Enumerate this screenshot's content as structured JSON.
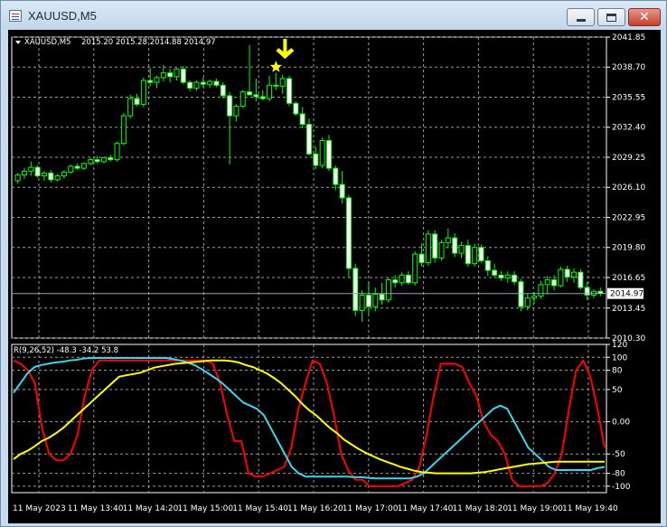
{
  "window": {
    "title": "XAUUSD,M5",
    "buttons": {
      "minimize": "minimize",
      "maximize": "maximize",
      "close": "close"
    }
  },
  "colors": {
    "background": "#000000",
    "grid": "#9a9a9a",
    "candle": "#00ff00",
    "candle_up_fill": "#000000",
    "candle_down_fill": "#ffffff",
    "price_line": "#8fa8b8",
    "arrow": "#ffff00",
    "indicator_red": "#ff0000",
    "indicator_cyan": "#3ad6f0",
    "indicator_yellow": "#ffff00"
  },
  "chart_data": [
    {
      "type": "candlestick",
      "symbol_label": "XAUUSD,M5",
      "ohlc_label": "2015.20 2015.28 2014.88 2014.97",
      "y_ticks": [
        "2041.85",
        "2038.70",
        "2035.55",
        "2032.40",
        "2029.25",
        "2026.10",
        "2022.95",
        "2019.80",
        "2016.65",
        "2013.45",
        "2010.30"
      ],
      "ylim": [
        2010.3,
        2041.85
      ],
      "current_price": "2014.97",
      "x_labels": [
        "11 May 2023",
        "11 May 13:40",
        "11 May 14:20",
        "11 May 15:00",
        "11 May 15:40",
        "11 May 16:20",
        "11 May 17:00",
        "11 May 17:40",
        "11 May 18:20",
        "11 May 19:00",
        "11 May 19:40"
      ],
      "marker": {
        "type": "down-arrow-star",
        "price": 2039.0,
        "bar_index": 39
      },
      "ohlc": [
        [
          2026.8,
          2027.6,
          2026.5,
          2027.4
        ],
        [
          2027.4,
          2028.1,
          2027.0,
          2027.8
        ],
        [
          2027.8,
          2028.8,
          2027.3,
          2028.2
        ],
        [
          2028.2,
          2028.4,
          2027.1,
          2027.3
        ],
        [
          2027.3,
          2027.8,
          2026.8,
          2027.6
        ],
        [
          2027.6,
          2027.9,
          2026.6,
          2026.9
        ],
        [
          2026.9,
          2027.5,
          2026.7,
          2027.3
        ],
        [
          2027.3,
          2027.9,
          2027.0,
          2027.7
        ],
        [
          2027.7,
          2028.5,
          2027.5,
          2028.3
        ],
        [
          2028.3,
          2028.6,
          2027.9,
          2028.1
        ],
        [
          2028.1,
          2028.7,
          2027.9,
          2028.6
        ],
        [
          2028.6,
          2029.2,
          2028.4,
          2029.0
        ],
        [
          2029.0,
          2029.4,
          2028.6,
          2028.8
        ],
        [
          2028.8,
          2029.3,
          2028.6,
          2029.2
        ],
        [
          2029.2,
          2029.5,
          2028.8,
          2029.0
        ],
        [
          2029.0,
          2030.9,
          2028.8,
          2030.7
        ],
        [
          2030.7,
          2033.9,
          2030.5,
          2033.6
        ],
        [
          2033.6,
          2035.8,
          2033.3,
          2035.4
        ],
        [
          2035.4,
          2035.9,
          2034.6,
          2034.8
        ],
        [
          2034.8,
          2037.6,
          2034.5,
          2037.3
        ],
        [
          2037.3,
          2038.6,
          2036.7,
          2037.1
        ],
        [
          2037.1,
          2037.8,
          2036.5,
          2037.6
        ],
        [
          2037.6,
          2038.9,
          2037.2,
          2038.1
        ],
        [
          2038.1,
          2038.5,
          2037.1,
          2037.7
        ],
        [
          2037.7,
          2038.6,
          2037.3,
          2038.5
        ],
        [
          2038.5,
          2038.8,
          2036.9,
          2037.1
        ],
        [
          2037.1,
          2037.3,
          2036.2,
          2036.5
        ],
        [
          2036.5,
          2037.3,
          2036.2,
          2037.1
        ],
        [
          2037.1,
          2037.6,
          2036.6,
          2036.9
        ],
        [
          2036.9,
          2037.4,
          2036.5,
          2037.2
        ],
        [
          2037.2,
          2037.5,
          2036.6,
          2036.8
        ],
        [
          2036.8,
          2037.1,
          2035.4,
          2035.7
        ],
        [
          2035.7,
          2036.1,
          2028.5,
          2033.6
        ],
        [
          2033.6,
          2034.8,
          2033.0,
          2034.6
        ],
        [
          2034.6,
          2036.3,
          2034.4,
          2036.1
        ],
        [
          2036.1,
          2041.0,
          2035.7,
          2035.8
        ],
        [
          2035.8,
          2037.5,
          2035.1,
          2035.6
        ],
        [
          2035.6,
          2036.3,
          2035.2,
          2035.4
        ],
        [
          2035.4,
          2037.8,
          2035.1,
          2036.8
        ],
        [
          2036.8,
          2038.1,
          2036.3,
          2036.7
        ],
        [
          2036.7,
          2037.9,
          2035.9,
          2037.5
        ],
        [
          2037.5,
          2037.8,
          2034.6,
          2034.9
        ],
        [
          2034.9,
          2035.1,
          2033.6,
          2033.8
        ],
        [
          2033.8,
          2034.5,
          2032.3,
          2032.7
        ],
        [
          2032.7,
          2033.3,
          2029.4,
          2029.6
        ],
        [
          2029.6,
          2030.4,
          2028.0,
          2028.4
        ],
        [
          2028.4,
          2031.3,
          2028.1,
          2031.0
        ],
        [
          2031.0,
          2031.6,
          2027.8,
          2028.1
        ],
        [
          2028.1,
          2028.4,
          2025.8,
          2026.4
        ],
        [
          2026.4,
          2027.8,
          2024.4,
          2025.0
        ],
        [
          2025.0,
          2025.3,
          2016.7,
          2017.6
        ],
        [
          2017.6,
          2018.1,
          2012.6,
          2013.2
        ],
        [
          2013.2,
          2015.3,
          2012.0,
          2014.8
        ],
        [
          2014.8,
          2016.2,
          2012.8,
          2013.6
        ],
        [
          2013.6,
          2015.6,
          2013.1,
          2014.9
        ],
        [
          2014.9,
          2016.1,
          2013.8,
          2014.3
        ],
        [
          2014.3,
          2016.7,
          2014.0,
          2016.4
        ],
        [
          2016.4,
          2016.9,
          2015.6,
          2016.1
        ],
        [
          2016.1,
          2017.2,
          2015.8,
          2016.9
        ],
        [
          2016.9,
          2017.3,
          2015.9,
          2016.1
        ],
        [
          2016.1,
          2019.4,
          2015.8,
          2019.1
        ],
        [
          2019.1,
          2020.2,
          2017.8,
          2018.2
        ],
        [
          2018.2,
          2021.6,
          2017.9,
          2021.2
        ],
        [
          2021.2,
          2021.6,
          2018.2,
          2018.7
        ],
        [
          2018.7,
          2020.6,
          2018.4,
          2020.3
        ],
        [
          2020.3,
          2021.8,
          2019.7,
          2020.8
        ],
        [
          2020.8,
          2021.3,
          2018.8,
          2019.2
        ],
        [
          2019.2,
          2020.4,
          2018.7,
          2020.0
        ],
        [
          2020.0,
          2020.6,
          2017.8,
          2018.1
        ],
        [
          2018.1,
          2020.2,
          2017.8,
          2019.8
        ],
        [
          2019.8,
          2020.1,
          2018.2,
          2018.4
        ],
        [
          2018.4,
          2018.9,
          2016.8,
          2017.4
        ],
        [
          2017.4,
          2018.1,
          2016.6,
          2016.9
        ],
        [
          2016.9,
          2017.3,
          2016.3,
          2016.6
        ],
        [
          2016.6,
          2017.3,
          2016.1,
          2016.9
        ],
        [
          2016.9,
          2017.3,
          2015.9,
          2016.2
        ],
        [
          2016.2,
          2016.5,
          2013.1,
          2013.6
        ],
        [
          2013.6,
          2014.9,
          2013.2,
          2014.5
        ],
        [
          2014.5,
          2015.1,
          2013.9,
          2014.7
        ],
        [
          2014.7,
          2016.3,
          2014.4,
          2015.9
        ],
        [
          2015.9,
          2016.8,
          2014.9,
          2016.4
        ],
        [
          2016.4,
          2016.9,
          2015.3,
          2015.8
        ],
        [
          2015.8,
          2017.8,
          2015.6,
          2017.5
        ],
        [
          2017.5,
          2017.9,
          2016.2,
          2016.7
        ],
        [
          2016.7,
          2017.6,
          2016.1,
          2017.2
        ],
        [
          2017.2,
          2017.5,
          2015.4,
          2015.6
        ],
        [
          2015.6,
          2016.2,
          2014.3,
          2014.8
        ],
        [
          2014.8,
          2015.4,
          2014.5,
          2015.2
        ],
        [
          2015.2,
          2015.6,
          2014.7,
          2014.97
        ]
      ]
    },
    {
      "type": "line",
      "label": "R(9,26,52) -48.3 -34.2 53.8",
      "y_ticks": [
        "120",
        "100",
        "80",
        "50",
        "0.00",
        "-50",
        "-80",
        "-100"
      ],
      "ylim": [
        -110,
        120
      ],
      "series": [
        {
          "color": "#ff0000",
          "values": [
            95,
            90,
            80,
            60,
            -10,
            -50,
            -60,
            -60,
            -50,
            -20,
            40,
            80,
            95,
            95,
            95,
            95,
            95,
            95,
            95,
            95,
            95,
            95,
            95,
            95,
            95,
            95,
            95,
            95,
            90,
            60,
            10,
            -30,
            -30,
            -80,
            -85,
            -85,
            -80,
            -75,
            -70,
            -40,
            20,
            60,
            95,
            90,
            60,
            10,
            -50,
            -75,
            -90,
            -90,
            -100,
            -100,
            -100,
            -100,
            -100,
            -95,
            -90,
            -70,
            -20,
            40,
            90,
            90,
            90,
            85,
            60,
            40,
            0,
            -20,
            -30,
            -50,
            -90,
            -100,
            -100,
            -100,
            -100,
            -95,
            -80,
            -50,
            20,
            80,
            95,
            70,
            20,
            -40
          ]
        },
        {
          "color": "#3ad6f0",
          "values": [
            45,
            60,
            75,
            85,
            88,
            90,
            92,
            93,
            95,
            96,
            98,
            99,
            99,
            99,
            99,
            99,
            99,
            99,
            99,
            99,
            99,
            99,
            99,
            97,
            95,
            92,
            88,
            82,
            75,
            68,
            60,
            50,
            40,
            30,
            25,
            20,
            10,
            -10,
            -30,
            -50,
            -70,
            -80,
            -85,
            -85,
            -85,
            -85,
            -85,
            -85,
            -85,
            -86,
            -86,
            -87,
            -88,
            -88,
            -88,
            -88,
            -88,
            -88,
            -85,
            -80,
            -70,
            -60,
            -50,
            -40,
            -30,
            -20,
            -10,
            0,
            10,
            20,
            25,
            20,
            0,
            -20,
            -40,
            -50,
            -60,
            -70,
            -75,
            -75,
            -75,
            -75,
            -75,
            -75,
            -72,
            -70
          ]
        },
        {
          "color": "#ffff00",
          "values": [
            -58,
            -50,
            -45,
            -38,
            -30,
            -25,
            -18,
            -10,
            0,
            10,
            20,
            30,
            40,
            50,
            60,
            70,
            72,
            74,
            76,
            80,
            84,
            86,
            88,
            90,
            91,
            92,
            93,
            94,
            95,
            95,
            95,
            94,
            92,
            88,
            85,
            80,
            75,
            68,
            60,
            50,
            40,
            28,
            18,
            10,
            0,
            -10,
            -18,
            -28,
            -35,
            -42,
            -48,
            -53,
            -58,
            -62,
            -66,
            -70,
            -73,
            -76,
            -78,
            -79,
            -80,
            -80,
            -80,
            -80,
            -80,
            -80,
            -79,
            -78,
            -76,
            -74,
            -72,
            -70,
            -68,
            -66,
            -65,
            -64,
            -63,
            -62,
            -62,
            -62,
            -62,
            -62,
            -62,
            -62,
            -62
          ]
        }
      ]
    }
  ]
}
